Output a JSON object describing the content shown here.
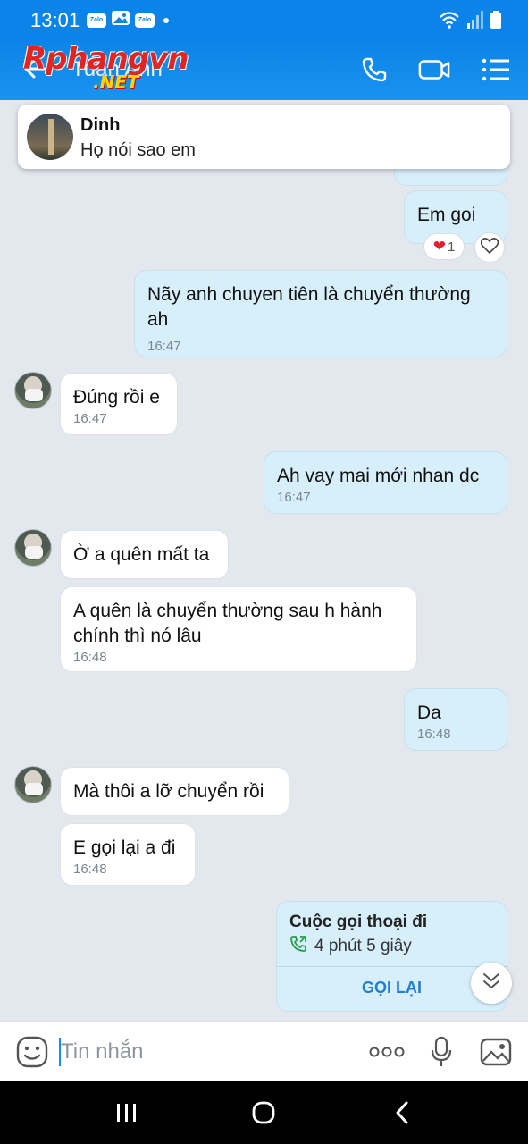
{
  "status_bar": {
    "time": "13:01",
    "badge_1": "Zalo",
    "badge_2": "Zalo"
  },
  "header": {
    "contact_name": "Tuan Anh",
    "watermark_main": "Rphangvn",
    "watermark_sub": ".NET"
  },
  "notification": {
    "sender": "Dinh",
    "message": "Họ nói sao em"
  },
  "messages": [
    {
      "side": "mine",
      "text": "Em goi",
      "time": ""
    },
    {
      "side": "mine",
      "text": "Nãy anh chuyen tiên là chuyển thường ah",
      "time": "16:47"
    },
    {
      "side": "theirs",
      "text": "Đúng rồi e",
      "time": "16:47"
    },
    {
      "side": "mine",
      "text": "Ah vay mai mới nhan dc",
      "time": "16:47"
    },
    {
      "side": "theirs",
      "text": "Ờ a quên mất ta",
      "time": ""
    },
    {
      "side": "theirs",
      "text": "A quên là chuyển thường sau h hành chính thì nó lâu",
      "time": "16:48"
    },
    {
      "side": "mine",
      "text": "Da",
      "time": "16:48"
    },
    {
      "side": "theirs",
      "text": "Mà thôi a lỡ chuyển rồi",
      "time": ""
    },
    {
      "side": "theirs",
      "text": "E gọi lại a đi",
      "time": "16:48"
    }
  ],
  "reaction": {
    "count": "1",
    "emoji": "❤"
  },
  "call_card": {
    "title": "Cuộc gọi thoại đi",
    "duration": "4 phút 5 giây",
    "action": "GỌI LẠI"
  },
  "input": {
    "placeholder": "Tin nhắn"
  },
  "colors": {
    "header_blue": "#0a84e8",
    "bubble_mine": "#d7eefb",
    "bubble_theirs": "#ffffff",
    "accent": "#1f7fd6"
  }
}
